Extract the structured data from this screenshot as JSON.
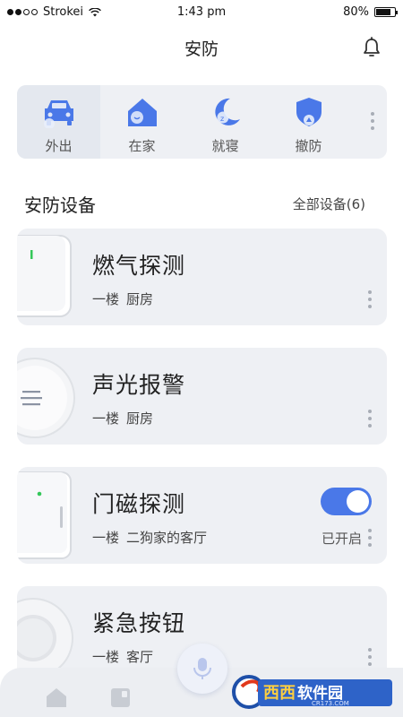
{
  "status_bar": {
    "carrier": "Strokei",
    "time": "1:43 pm",
    "battery": "80%",
    "battery_level": 0.8
  },
  "header": {
    "title": "安防",
    "bell_icon": "bell-icon"
  },
  "modes": [
    {
      "label": "外出",
      "icon": "car-icon",
      "active": true
    },
    {
      "label": "在家",
      "icon": "home-icon",
      "active": false
    },
    {
      "label": "就寝",
      "icon": "moon-icon",
      "active": false
    },
    {
      "label": "撤防",
      "icon": "shield-icon",
      "active": false
    }
  ],
  "section": {
    "title": "安防设备",
    "all_devices": "全部设备(6)"
  },
  "devices": [
    {
      "name": "燃气探测",
      "floor": "一楼",
      "room": "厨房",
      "icon": "gas-detector-icon"
    },
    {
      "name": "声光报警",
      "floor": "一楼",
      "room": "厨房",
      "icon": "alarm-siren-icon"
    },
    {
      "name": "门磁探测",
      "floor": "一楼",
      "room": "二狗家的客厅",
      "icon": "door-sensor-icon",
      "toggle_on": true,
      "state": "已开启"
    },
    {
      "name": "紧急按钮",
      "floor": "一楼",
      "room": "客厅",
      "icon": "emergency-button-icon"
    }
  ],
  "bottom_nav": {
    "items": [
      {
        "icon": "home-icon"
      },
      {
        "icon": "devices-icon"
      }
    ],
    "mic_icon": "microphone-icon"
  },
  "watermark": {
    "logo_text": "西西软件园",
    "sub_text": "CR173.COM"
  },
  "colors": {
    "accent": "#4a78e8",
    "card_bg": "#eef0f4",
    "mode_icon": "#4a78e8"
  }
}
